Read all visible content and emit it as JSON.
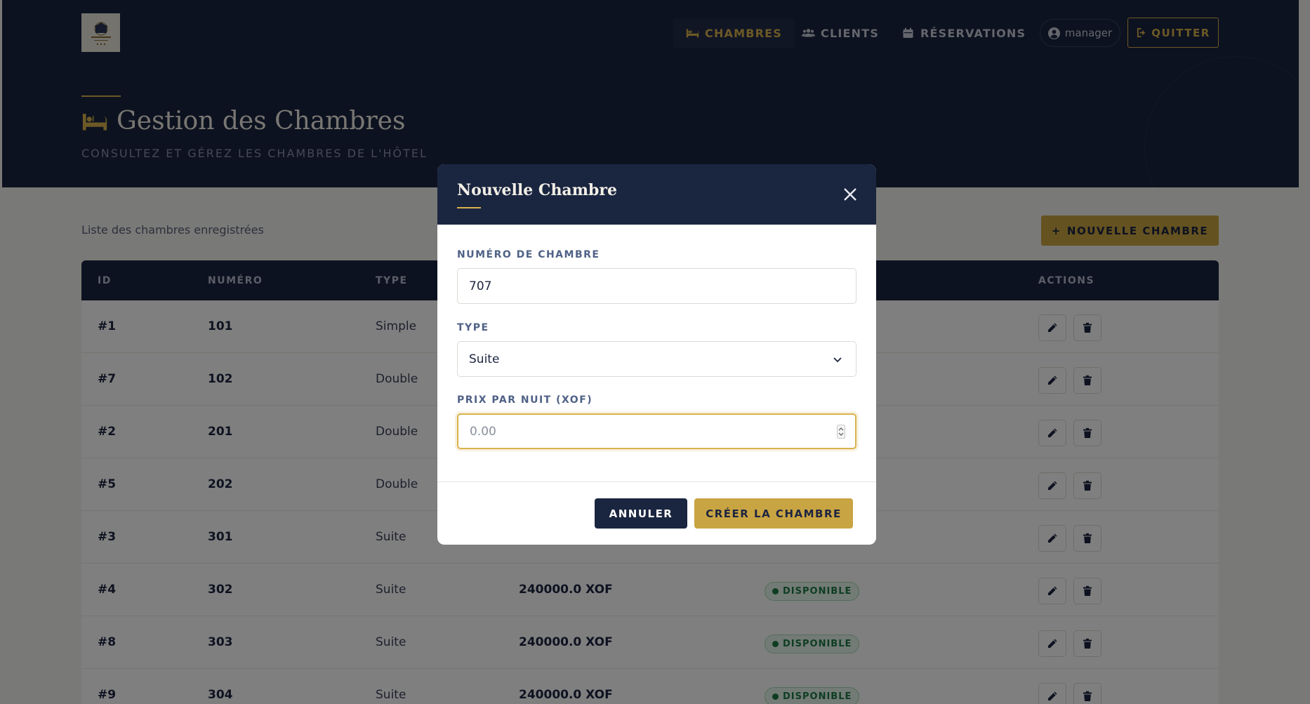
{
  "nav": {
    "rooms": "CHAMBRES",
    "clients": "CLIENTS",
    "reservations": "RÉSERVATIONS",
    "user": "manager",
    "quit": "QUITTER"
  },
  "header": {
    "title": "Gestion des Chambres",
    "subtitle": "CONSULTEZ ET GÉREZ LES CHAMBRES DE L'HÔTEL"
  },
  "main": {
    "list_label": "Liste des chambres enregistrées",
    "new_button": "NOUVELLE CHAMBRE"
  },
  "table": {
    "headers": {
      "id": "ID",
      "number": "NUMÉRO",
      "type": "TYPE",
      "actions": "ACTIONS"
    },
    "rows": [
      {
        "id": "#1",
        "number": "101",
        "type": "Simple",
        "price": "",
        "status": ""
      },
      {
        "id": "#7",
        "number": "102",
        "type": "Double",
        "price": "",
        "status": ""
      },
      {
        "id": "#2",
        "number": "201",
        "type": "Double",
        "price": "",
        "status": ""
      },
      {
        "id": "#5",
        "number": "202",
        "type": "Double",
        "price": "",
        "status": ""
      },
      {
        "id": "#3",
        "number": "301",
        "type": "Suite",
        "price": "",
        "status": ""
      },
      {
        "id": "#4",
        "number": "302",
        "type": "Suite",
        "price": "240000.0 XOF",
        "status": "DISPONIBLE"
      },
      {
        "id": "#8",
        "number": "303",
        "type": "Suite",
        "price": "240000.0 XOF",
        "status": "DISPONIBLE"
      },
      {
        "id": "#9",
        "number": "304",
        "type": "Suite",
        "price": "240000.0 XOF",
        "status": "DISPONIBLE"
      }
    ]
  },
  "modal": {
    "title": "Nouvelle Chambre",
    "number_label": "NUMÉRO DE CHAMBRE",
    "number_value": "707",
    "type_label": "TYPE",
    "type_value": "Suite",
    "price_label": "PRIX PAR NUIT (XOF)",
    "price_placeholder": "0.00",
    "cancel": "ANNULER",
    "create": "CRÉER LA CHAMBRE"
  },
  "colors": {
    "navy": "#1a2540",
    "gold": "#c9a443",
    "success": "#1d7a45"
  }
}
